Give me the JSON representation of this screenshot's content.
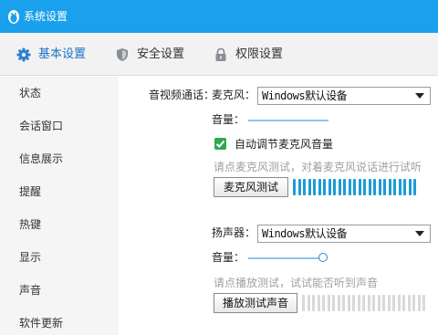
{
  "window": {
    "title": "系统设置"
  },
  "tabs": [
    {
      "label": "基本设置",
      "icon": "gear-icon",
      "active": true
    },
    {
      "label": "安全设置",
      "icon": "shield-icon",
      "active": false
    },
    {
      "label": "权限设置",
      "icon": "lock-icon",
      "active": false
    }
  ],
  "sidebar": {
    "items": [
      {
        "label": "状态"
      },
      {
        "label": "会话窗口"
      },
      {
        "label": "信息展示"
      },
      {
        "label": "提醒"
      },
      {
        "label": "热键"
      },
      {
        "label": "显示"
      },
      {
        "label": "声音"
      },
      {
        "label": "软件更新"
      }
    ]
  },
  "audio_video": {
    "section_label": "音视频通话：",
    "microphone": {
      "label": "麦克风：",
      "device": "Windows默认设备",
      "volume_label": "音量：",
      "volume_level": 1.0,
      "auto_adjust_checked": true,
      "auto_adjust_label": "自动调节麦克风音量",
      "test_hint": "请点麦克风测试，对着麦克风说话进行试听",
      "test_button": "麦克风测试",
      "meter_active": true
    },
    "speaker": {
      "label": "扬声器：",
      "device": "Windows默认设备",
      "volume_label": "音量：",
      "volume_level": 1.0,
      "test_hint": "请点播放测试，试试能否听到声音",
      "test_button": "播放测试声音",
      "meter_active": false
    }
  },
  "colors": {
    "titlebar": "#1aa0ec",
    "meter_active": "#1c9bd8",
    "meter_inactive": "#d9d9d9",
    "checkbox": "#2fa84f"
  }
}
